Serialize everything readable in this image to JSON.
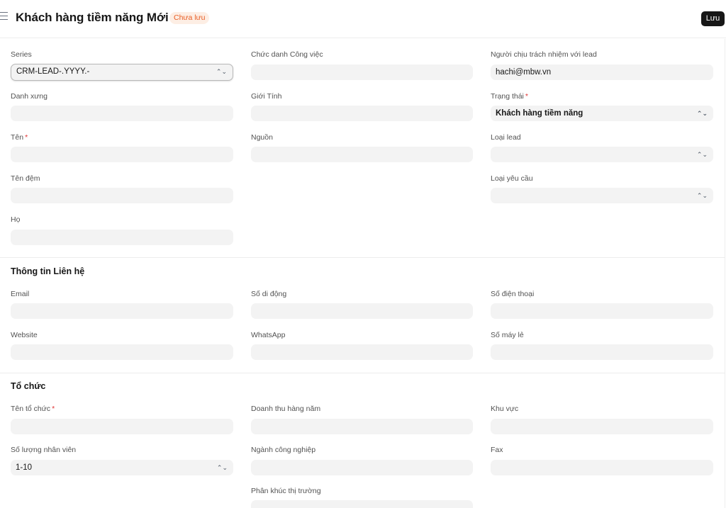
{
  "header": {
    "title": "Khách hàng tiềm năng Mới",
    "status": "Chưa lưu",
    "save_label": "Lưu"
  },
  "fields": {
    "series": {
      "label": "Series",
      "value": "CRM-LEAD-.YYYY.-"
    },
    "job_title": {
      "label": "Chức danh Công việc",
      "value": ""
    },
    "lead_owner": {
      "label": "Người chịu trách nhiệm với lead",
      "value": "hachi@mbw.vn"
    },
    "salutation": {
      "label": "Danh xưng",
      "value": ""
    },
    "gender": {
      "label": "Giới Tính",
      "value": ""
    },
    "status": {
      "label": "Trạng thái",
      "value": "Khách hàng tiềm năng"
    },
    "first_name": {
      "label": "Tên",
      "value": ""
    },
    "source": {
      "label": "Nguồn",
      "value": ""
    },
    "lead_type": {
      "label": "Loại lead",
      "value": ""
    },
    "middle_name": {
      "label": "Tên đệm",
      "value": ""
    },
    "request_type": {
      "label": "Loại yêu cầu",
      "value": ""
    },
    "last_name": {
      "label": "Họ",
      "value": ""
    }
  },
  "contact_section": {
    "title": "Thông tin Liên hệ",
    "email": {
      "label": "Email",
      "value": ""
    },
    "mobile": {
      "label": "Số di động",
      "value": ""
    },
    "phone": {
      "label": "Số điện thoại",
      "value": ""
    },
    "website": {
      "label": "Website",
      "value": ""
    },
    "whatsapp": {
      "label": "WhatsApp",
      "value": ""
    },
    "phone_ext": {
      "label": "Số máy lẻ",
      "value": ""
    }
  },
  "organization_section": {
    "title": "Tổ chức",
    "company_name": {
      "label": "Tên tổ chức",
      "value": ""
    },
    "annual_revenue": {
      "label": "Doanh thu hàng năm",
      "value": ""
    },
    "territory": {
      "label": "Khu vực",
      "value": ""
    },
    "no_of_employees": {
      "label": "Số lượng nhân viên",
      "value": "1-10"
    },
    "industry": {
      "label": "Ngành công nghiệp",
      "value": ""
    },
    "fax": {
      "label": "Fax",
      "value": ""
    },
    "market_segment": {
      "label": "Phân khúc thị trường",
      "value": ""
    }
  },
  "required_mark": "*",
  "icons": {
    "menu": "hamburger-menu-icon",
    "select": "select-chevron-icon"
  },
  "colors": {
    "badge_bg": "#fdeee4",
    "badge_text": "#e85c23",
    "save_bg": "#171717",
    "required": "#e03636",
    "input_bg": "#f3f3f3"
  }
}
